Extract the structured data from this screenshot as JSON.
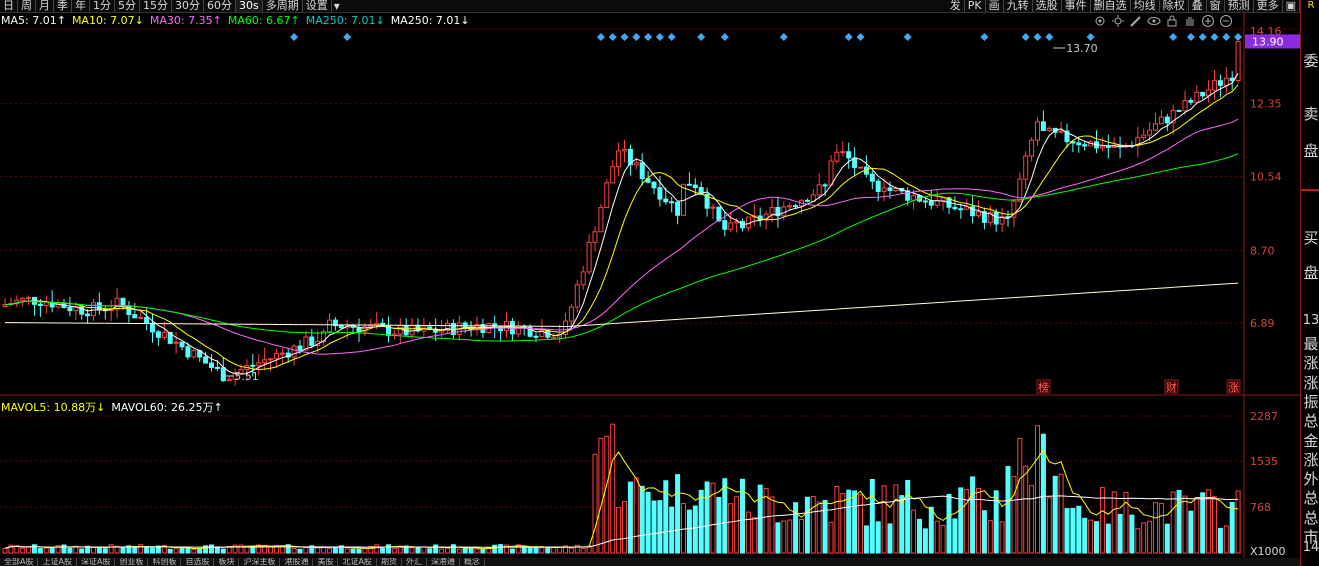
{
  "toolbar": {
    "left_buttons": [
      "日",
      "周",
      "月",
      "季",
      "年",
      "1分",
      "5分",
      "15分",
      "30分",
      "60分",
      "30s",
      "多周期",
      "设置"
    ],
    "right_buttons": [
      "发",
      "PK",
      "画",
      "九转",
      "选股",
      "事件",
      "删自选",
      "均线",
      "除权",
      "叠",
      "窗",
      "预测",
      "更多"
    ]
  },
  "right_column": {
    "top_letter": "R",
    "labels": [
      "委",
      "卖",
      "盘",
      "买",
      "盘"
    ],
    "number_label": "13",
    "stats_labels": [
      "最",
      "涨",
      "涨",
      "振",
      "总",
      "金",
      "涨",
      "外",
      "总",
      "总",
      "市"
    ],
    "bottom_label": "14"
  },
  "ma_legend": [
    {
      "label": "MA5: 7.01",
      "arrow": "↑",
      "color": "#ffffff"
    },
    {
      "label": "MA10: 7.07",
      "arrow": "↓",
      "color": "#ffff00"
    },
    {
      "label": "MA30: 7.35",
      "arrow": "↑",
      "color": "#ff66ff"
    },
    {
      "label": "MA60: 6.67",
      "arrow": "↑",
      "color": "#00ff00"
    },
    {
      "label": "MA250: 7.01",
      "arrow": "↓",
      "color": "#00cccc"
    },
    {
      "label": "MA250: 7.01",
      "arrow": "↓",
      "color": "#ffffff"
    }
  ],
  "vol_legend": [
    {
      "label": "MAVOL5: 10.88万",
      "arrow": "↓",
      "color": "#ffff00"
    },
    {
      "label": "MAVOL60: 26.25万",
      "arrow": "↑",
      "color": "#ffffff"
    }
  ],
  "price_axis": {
    "ticks": [
      "14.16",
      "12.35",
      "10.54",
      "8.70",
      "6.89"
    ],
    "current_price": "13.90"
  },
  "volume_axis": {
    "ticks": [
      "2287",
      "1535",
      "768"
    ],
    "unit": "X1000"
  },
  "annotations": {
    "high_label": "13.70",
    "low_label": "5.51",
    "markers": [
      "榜",
      "财",
      "涨"
    ]
  },
  "bottom_tabs": [
    "全部A股",
    "上证A股",
    "深证A股",
    "创业板",
    "科创板",
    "自选股",
    "板块",
    "沪深主板",
    "港股通",
    "美股",
    "北证A股",
    "期货",
    "外汇",
    "深港通",
    "概念"
  ],
  "colors": {
    "up": "#ff4040",
    "down": "#54ffff",
    "grid": "#6b0000",
    "price_label_bg": "#8a2be2"
  },
  "chart_data": {
    "type": "candlestick",
    "ma_lines": [
      "MA5",
      "MA10",
      "MA30",
      "MA60",
      "MA250"
    ],
    "price_range": [
      5.0,
      14.5
    ],
    "volume_range": [
      0,
      2300
    ],
    "high": 13.7,
    "low": 5.51,
    "last": 13.9,
    "volume_unit": "X1000"
  }
}
